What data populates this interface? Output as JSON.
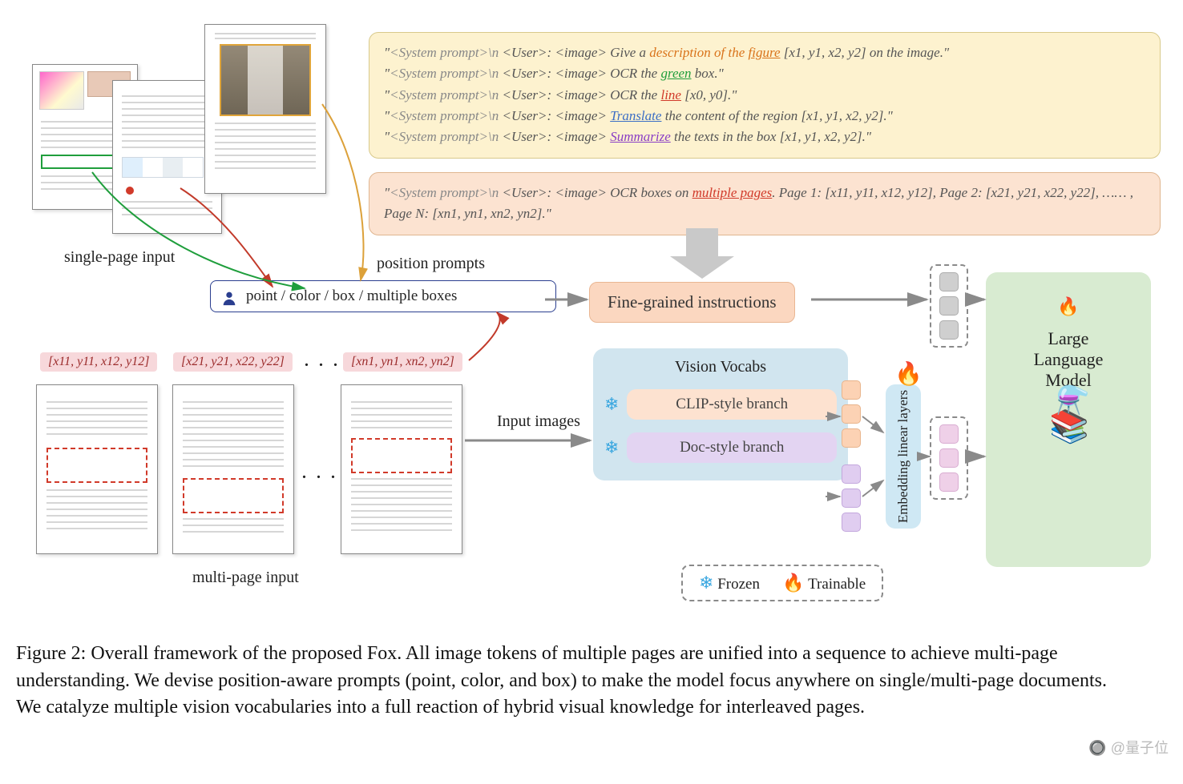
{
  "prompts": {
    "sys": "<System prompt>",
    "nl": "\\n ",
    "user": "<User>",
    "img": "<image>",
    "p1a": " Give a ",
    "p1b": "description of the ",
    "p1c": "figure",
    "p1d": " [x1, y1, x2, y2] on the image.\"",
    "p2a": " OCR the ",
    "p2b": "green",
    "p2c": " box.\"",
    "p3a": " OCR the ",
    "p3b": "line",
    "p3c": " [x0, y0].\"",
    "p4a": " ",
    "p4b": "Translate",
    "p4c": " the content of the region [x1, y1, x2, y2].\"",
    "p5a": " ",
    "p5b": "Summarize",
    "p5c": " the texts in the box [x1, y1, x2, y2].\"",
    "mp_a": " OCR boxes on ",
    "mp_b": "multiple pages",
    "mp_c": ". Page 1: [x11, y11, x12, y12], Page 2: [x21, y21, x22, y22], …… , Page N: [xn1, yn1, xn2, yn2].\""
  },
  "labels": {
    "single_page": "single-page input",
    "multi_page": "multi-page input",
    "position_prompts": "position prompts",
    "input_images": "Input images",
    "pos_box": "point / color / box / multiple boxes",
    "fine": "Fine-grained instructions",
    "vision_vocabs": "Vision Vocabs",
    "clip": "CLIP-style branch",
    "doc": "Doc-style branch",
    "embed": "Embedding linear layers",
    "llm1": "Large",
    "llm2": "Language",
    "llm3": "Model",
    "frozen": "Frozen",
    "trainable": "Trainable"
  },
  "coords": {
    "c1": "[x11, y11, x12, y12]",
    "c2": "[x21, y21, x22, y22]",
    "cn": "[xn1, yn1, xn2, yn2]",
    "dots": ". . ."
  },
  "caption": "Figure 2: Overall framework of the proposed Fox. All image tokens of multiple pages are unified into a sequence to achieve multi-page understanding. We devise position-aware prompts (point, color, and box) to make the model focus anywhere on single/multi-page documents. We catalyze multiple vision vocabularies into a full reaction of hybrid visual knowledge for interleaved pages.",
  "watermark": "@量子位"
}
